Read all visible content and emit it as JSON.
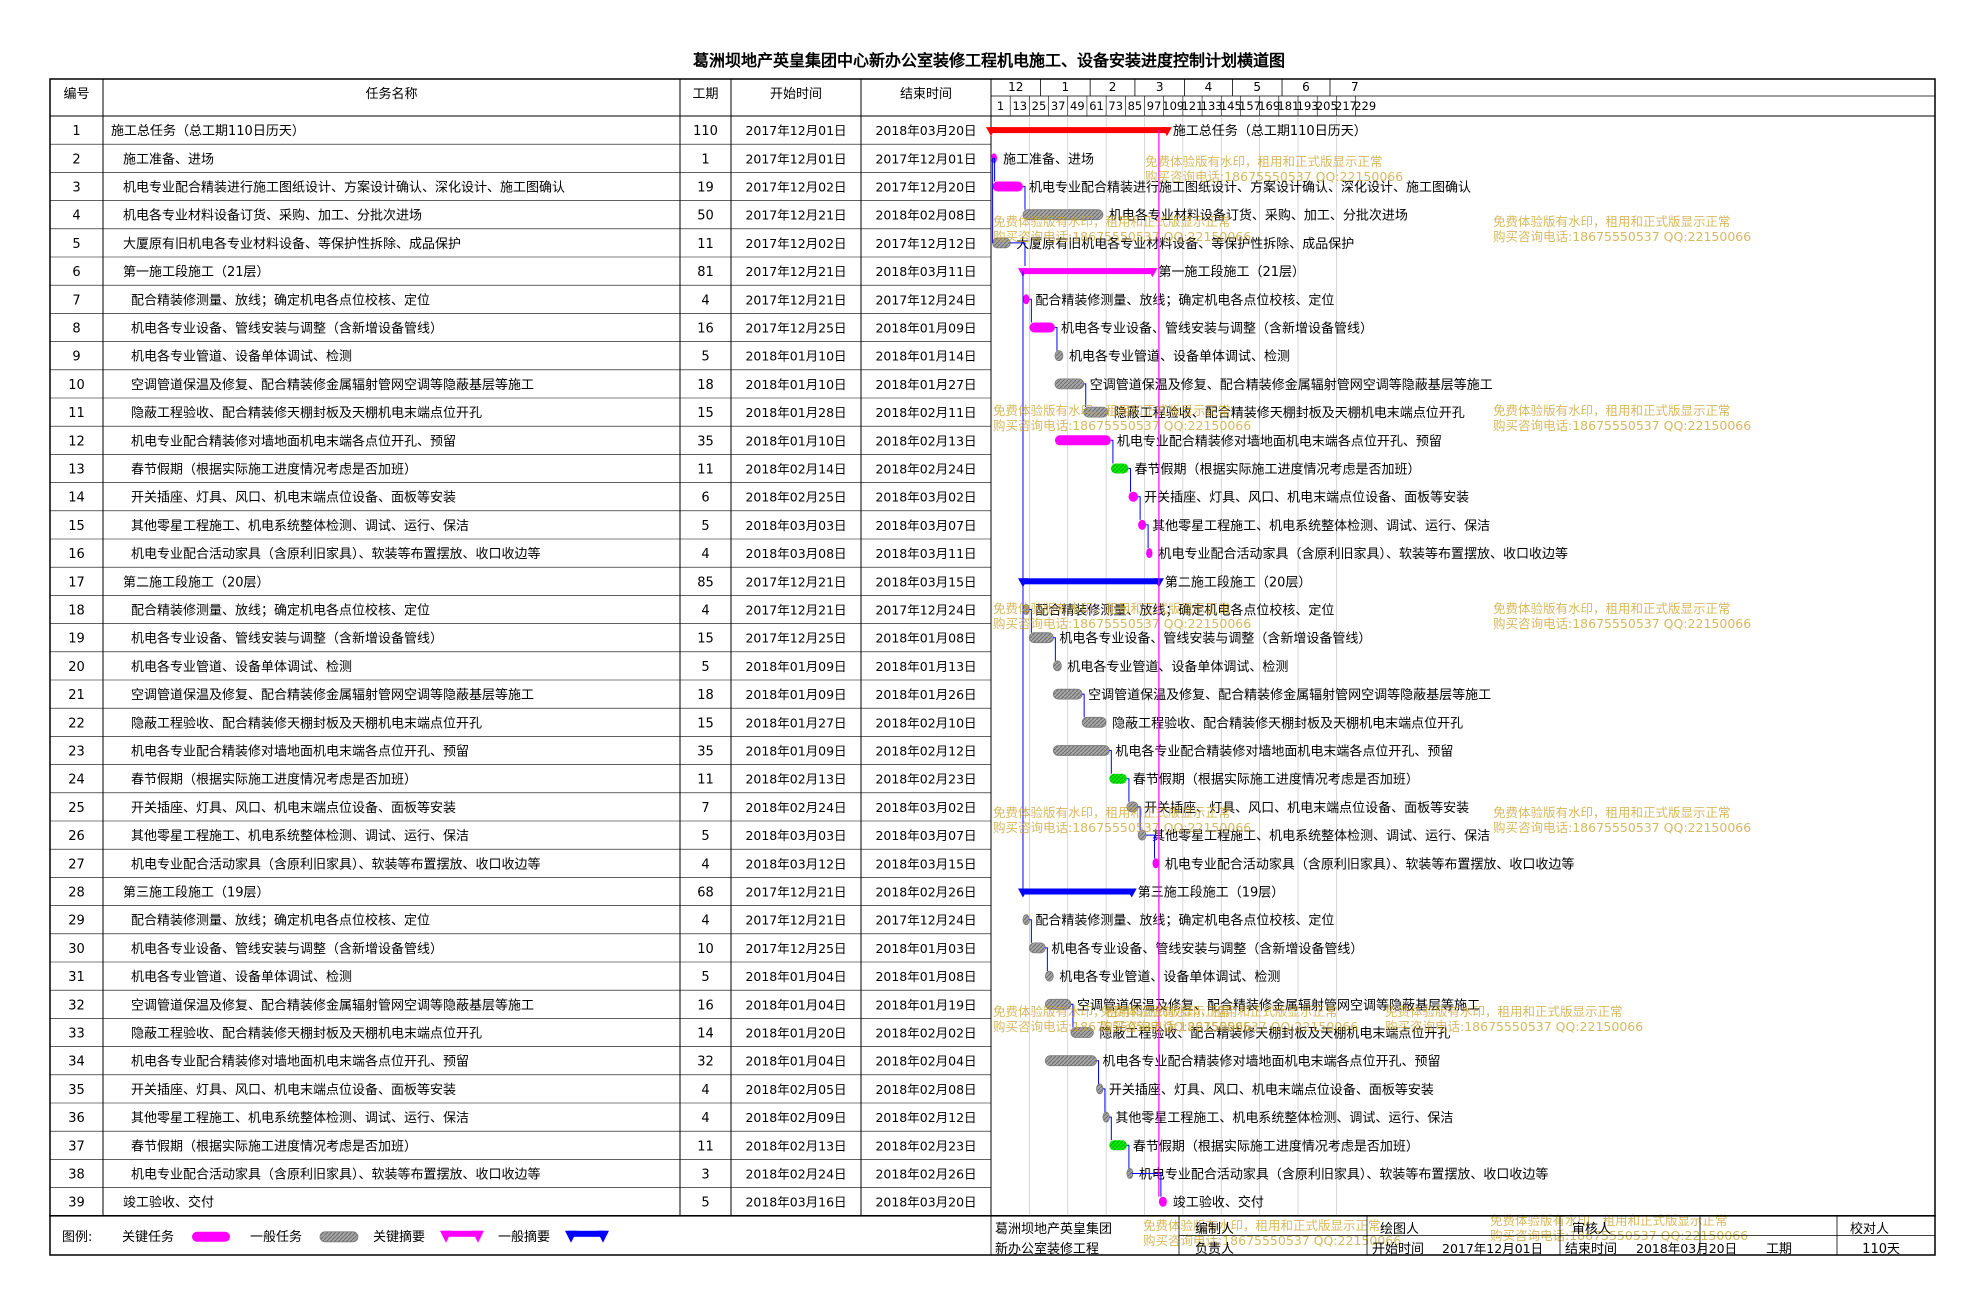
{
  "title": "葛洲坝地产英皇集团中心新办公室装修工程机电施工、设备安装进度控制计划横道图",
  "headers": {
    "id": "编号",
    "name": "任务名称",
    "dur": "工期",
    "start": "开始时间",
    "end": "结束时间"
  },
  "timeline": {
    "months": [
      "12",
      "1",
      "2",
      "3",
      "4",
      "5",
      "6",
      "7"
    ],
    "days": [
      "1",
      "13",
      "25",
      "37",
      "49",
      "61",
      "73",
      "85",
      "97",
      "109",
      "121",
      "133",
      "145",
      "157",
      "169",
      "181",
      "193",
      "205",
      "217",
      "229"
    ]
  },
  "chart_data": {
    "type": "gantt",
    "project_start": "2017-12-01",
    "tasks": [
      {
        "id": "1",
        "name": "施工总任务（总工期110日历天）",
        "dur": "110",
        "start": "2017年12月01日",
        "end": "2018年03月20日",
        "label": "施工总任务（总工期110日历天）",
        "kind": "kcs"
      },
      {
        "id": "2",
        "name": "施工准备、进场",
        "dur": "1",
        "start": "2017年12月01日",
        "end": "2017年12月01日",
        "label": "施工准备、进场",
        "kind": "kc"
      },
      {
        "id": "3",
        "name": "机电专业配合精装进行施工图纸设计、方案设计确认、深化设计、施工图确认",
        "dur": "19",
        "start": "2017年12月02日",
        "end": "2017年12月20日",
        "label": "机电专业配合精装进行施工图纸设计、方案设计确认、深化设计、施工图确认",
        "kind": "kc"
      },
      {
        "id": "4",
        "name": "机电各专业材料设备订货、采购、加工、分批次进场",
        "dur": "50",
        "start": "2017年12月21日",
        "end": "2018年02月08日",
        "label": "机电各专业材料设备订货、采购、加工、分批次进场",
        "kind": "gt"
      },
      {
        "id": "5",
        "name": "大厦原有旧机电各专业材料设备、等保护性拆除、成品保护",
        "dur": "11",
        "start": "2017年12月02日",
        "end": "2017年12月12日",
        "label": "大厦原有旧机电各专业材料设备、等保护性拆除、成品保护",
        "kind": "gt"
      },
      {
        "id": "6",
        "name": "第一施工段施工（21层）",
        "dur": "81",
        "start": "2017年12月21日",
        "end": "2018年03月11日",
        "label": "第一施工段施工（21层）",
        "kind": "kcs"
      },
      {
        "id": "7",
        "name": "配合精装修测量、放线；确定机电各点位校核、定位",
        "dur": "4",
        "start": "2017年12月21日",
        "end": "2017年12月24日",
        "label": "配合精装修测量、放线；确定机电各点位校核、定位",
        "kind": "kc"
      },
      {
        "id": "8",
        "name": "机电各专业设备、管线安装与调整（含新增设备管线）",
        "dur": "16",
        "start": "2017年12月25日",
        "end": "2018年01月09日",
        "label": "机电各专业设备、管线安装与调整（含新增设备管线）",
        "kind": "kc"
      },
      {
        "id": "9",
        "name": "机电各专业管道、设备单体调试、检测",
        "dur": "5",
        "start": "2018年01月10日",
        "end": "2018年01月14日",
        "label": "机电各专业管道、设备单体调试、检测",
        "kind": "gt"
      },
      {
        "id": "10",
        "name": "空调管道保温及修复、配合精装修金属辐射管网空调等隐蔽基层等施工",
        "dur": "18",
        "start": "2018年01月10日",
        "end": "2018年01月27日",
        "label": "空调管道保温及修复、配合精装修金属辐射管网空调等隐蔽基层等施工",
        "kind": "gt"
      },
      {
        "id": "11",
        "name": "隐蔽工程验收、配合精装修天棚封板及天棚机电末端点位开孔",
        "dur": "15",
        "start": "2018年01月28日",
        "end": "2018年02月11日",
        "label": "隐蔽工程验收、配合精装修天棚封板及天棚机电末端点位开孔",
        "kind": "gt"
      },
      {
        "id": "12",
        "name": "机电专业配合精装修对墙地面机电末端各点位开孔、预留",
        "dur": "35",
        "start": "2018年01月10日",
        "end": "2018年02月13日",
        "label": "机电专业配合精装修对墙地面机电末端各点位开孔、预留",
        "kind": "kc"
      },
      {
        "id": "13",
        "name": "春节假期（根据实际施工进度情况考虑是否加班）",
        "dur": "11",
        "start": "2018年02月14日",
        "end": "2018年02月24日",
        "label": "春节假期（根据实际施工进度情况考虑是否加班）",
        "kind": "green"
      },
      {
        "id": "14",
        "name": "开关插座、灯具、风口、机电末端点位设备、面板等安装",
        "dur": "6",
        "start": "2018年02月25日",
        "end": "2018年03月02日",
        "label": "开关插座、灯具、风口、机电末端点位设备、面板等安装",
        "kind": "kc"
      },
      {
        "id": "15",
        "name": "其他零星工程施工、机电系统整体检测、调试、运行、保洁",
        "dur": "5",
        "start": "2018年03月03日",
        "end": "2018年03月07日",
        "label": "其他零星工程施工、机电系统整体检测、调试、运行、保洁",
        "kind": "kc"
      },
      {
        "id": "16",
        "name": "机电专业配合活动家具（含原利旧家具）、软装等布置摆放、收口收边等",
        "dur": "4",
        "start": "2018年03月08日",
        "end": "2018年03月11日",
        "label": "机电专业配合活动家具（含原利旧家具）、软装等布置摆放、收口收边等",
        "kind": "kc"
      },
      {
        "id": "17",
        "name": "第二施工段施工（20层）",
        "dur": "85",
        "start": "2017年12月21日",
        "end": "2018年03月15日",
        "label": "第二施工段施工（20层）",
        "kind": "gs"
      },
      {
        "id": "18",
        "name": "配合精装修测量、放线；确定机电各点位校核、定位",
        "dur": "4",
        "start": "2017年12月21日",
        "end": "2017年12月24日",
        "label": "配合精装修测量、放线；确定机电各点位校核、定位",
        "kind": "gt"
      },
      {
        "id": "19",
        "name": "机电各专业设备、管线安装与调整（含新增设备管线）",
        "dur": "15",
        "start": "2017年12月25日",
        "end": "2018年01月08日",
        "label": "机电各专业设备、管线安装与调整（含新增设备管线）",
        "kind": "gt"
      },
      {
        "id": "20",
        "name": "机电各专业管道、设备单体调试、检测",
        "dur": "5",
        "start": "2018年01月09日",
        "end": "2018年01月13日",
        "label": "机电各专业管道、设备单体调试、检测",
        "kind": "gt"
      },
      {
        "id": "21",
        "name": "空调管道保温及修复、配合精装修金属辐射管网空调等隐蔽基层等施工",
        "dur": "18",
        "start": "2018年01月09日",
        "end": "2018年01月26日",
        "label": "空调管道保温及修复、配合精装修金属辐射管网空调等隐蔽基层等施工",
        "kind": "gt"
      },
      {
        "id": "22",
        "name": "隐蔽工程验收、配合精装修天棚封板及天棚机电末端点位开孔",
        "dur": "15",
        "start": "2018年01月27日",
        "end": "2018年02月10日",
        "label": "隐蔽工程验收、配合精装修天棚封板及天棚机电末端点位开孔",
        "kind": "gt"
      },
      {
        "id": "23",
        "name": "机电各专业配合精装修对墙地面机电末端各点位开孔、预留",
        "dur": "35",
        "start": "2018年01月09日",
        "end": "2018年02月12日",
        "label": "机电各专业配合精装修对墙地面机电末端各点位开孔、预留",
        "kind": "gt"
      },
      {
        "id": "24",
        "name": "春节假期（根据实际施工进度情况考虑是否加班）",
        "dur": "11",
        "start": "2018年02月13日",
        "end": "2018年02月23日",
        "label": "春节假期（根据实际施工进度情况考虑是否加班）",
        "kind": "green"
      },
      {
        "id": "25",
        "name": "开关插座、灯具、风口、机电末端点位设备、面板等安装",
        "dur": "7",
        "start": "2018年02月24日",
        "end": "2018年03月02日",
        "label": "开关插座、灯具、风口、机电末端点位设备、面板等安装",
        "kind": "gt"
      },
      {
        "id": "26",
        "name": "其他零星工程施工、机电系统整体检测、调试、运行、保洁",
        "dur": "5",
        "start": "2018年03月03日",
        "end": "2018年03月07日",
        "label": "其他零星工程施工、机电系统整体检测、调试、运行、保洁",
        "kind": "gt"
      },
      {
        "id": "27",
        "name": "机电专业配合活动家具（含原利旧家具）、软装等布置摆放、收口收边等",
        "dur": "4",
        "start": "2018年03月12日",
        "end": "2018年03月15日",
        "label": "机电专业配合活动家具（含原利旧家具）、软装等布置摆放、收口收边等",
        "kind": "kc"
      },
      {
        "id": "28",
        "name": "第三施工段施工（19层）",
        "dur": "68",
        "start": "2017年12月21日",
        "end": "2018年02月26日",
        "label": "第三施工段施工（19层）",
        "kind": "gs"
      },
      {
        "id": "29",
        "name": "配合精装修测量、放线；确定机电各点位校核、定位",
        "dur": "4",
        "start": "2017年12月21日",
        "end": "2017年12月24日",
        "label": "配合精装修测量、放线；确定机电各点位校核、定位",
        "kind": "gt"
      },
      {
        "id": "30",
        "name": "机电各专业设备、管线安装与调整（含新增设备管线）",
        "dur": "10",
        "start": "2017年12月25日",
        "end": "2018年01月03日",
        "label": "机电各专业设备、管线安装与调整（含新增设备管线）",
        "kind": "gt"
      },
      {
        "id": "31",
        "name": "机电各专业管道、设备单体调试、检测",
        "dur": "5",
        "start": "2018年01月04日",
        "end": "2018年01月08日",
        "label": "机电各专业管道、设备单体调试、检测",
        "kind": "gt"
      },
      {
        "id": "32",
        "name": "空调管道保温及修复、配合精装修金属辐射管网空调等隐蔽基层等施工",
        "dur": "16",
        "start": "2018年01月04日",
        "end": "2018年01月19日",
        "label": "空调管道保温及修复、配合精装修金属辐射管网空调等隐蔽基层等施工",
        "kind": "gt"
      },
      {
        "id": "33",
        "name": "隐蔽工程验收、配合精装修天棚封板及天棚机电末端点位开孔",
        "dur": "14",
        "start": "2018年01月20日",
        "end": "2018年02月02日",
        "label": "隐蔽工程验收、配合精装修天棚封板及天棚机电末端点位开孔",
        "kind": "gt"
      },
      {
        "id": "34",
        "name": "机电各专业配合精装修对墙地面机电末端各点位开孔、预留",
        "dur": "32",
        "start": "2018年01月04日",
        "end": "2018年02月04日",
        "label": "机电各专业配合精装修对墙地面机电末端各点位开孔、预留",
        "kind": "gt"
      },
      {
        "id": "35",
        "name": "开关插座、灯具、风口、机电末端点位设备、面板等安装",
        "dur": "4",
        "start": "2018年02月05日",
        "end": "2018年02月08日",
        "label": "开关插座、灯具、风口、机电末端点位设备、面板等安装",
        "kind": "gt"
      },
      {
        "id": "36",
        "name": "其他零星工程施工、机电系统整体检测、调试、运行、保洁",
        "dur": "4",
        "start": "2018年02月09日",
        "end": "2018年02月12日",
        "label": "其他零星工程施工、机电系统整体检测、调试、运行、保洁",
        "kind": "gt"
      },
      {
        "id": "37",
        "name": "春节假期（根据实际施工进度情况考虑是否加班）",
        "dur": "11",
        "start": "2018年02月13日",
        "end": "2018年02月23日",
        "label": "春节假期（根据实际施工进度情况考虑是否加班）",
        "kind": "green"
      },
      {
        "id": "38",
        "name": "机电专业配合活动家具（含原利旧家具）、软装等布置摆放、收口收边等",
        "dur": "3",
        "start": "2018年02月24日",
        "end": "2018年02月26日",
        "label": "机电专业配合活动家具（含原利旧家具）、软装等布置摆放、收口收边等",
        "kind": "gt"
      },
      {
        "id": "39",
        "name": "竣工验收、交付",
        "dur": "5",
        "start": "2018年03月16日",
        "end": "2018年03月20日",
        "label": "竣工验收、交付",
        "kind": "kc"
      }
    ]
  },
  "legend": {
    "label": "图例:",
    "items": [
      "关键任务",
      "一般任务",
      "关键摘要",
      "一般摘要"
    ],
    "colors": {
      "critical": "#ff00ff",
      "normal": "#808080",
      "critical_summary": "#ff00ff",
      "normal_summary": "#0000ff",
      "total": "#ff0000",
      "holiday": "#00ff00",
      "link": "#0000ff"
    }
  },
  "footer": {
    "company": "葛洲坝地产英皇集团",
    "project": "新办公室装修工程",
    "compiler": "编制人",
    "manager": "负责人",
    "drawer": "绘图人",
    "reviewer": "审核人",
    "checker": "校对人",
    "start_label": "开始时间",
    "start_value": "2017年12月01日",
    "end_label": "结束时间",
    "end_value": "2018年03月20日",
    "dur_label": "工期",
    "dur_value": "110天"
  },
  "watermark": {
    "line1": "免费体验版有水印，租用和正式版显示正常",
    "line2": "购买咨询电话:18675550537 QQ:22150066"
  }
}
